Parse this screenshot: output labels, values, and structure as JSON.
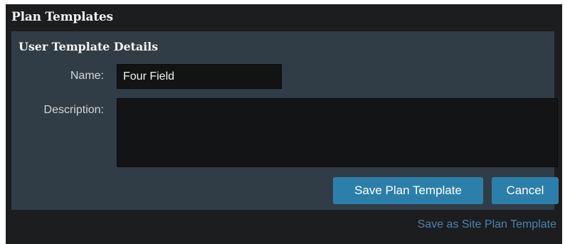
{
  "window": {
    "title": "Plan Templates"
  },
  "panel": {
    "title": "User Template Details",
    "name_label": "Name:",
    "name_value": "Four Field",
    "description_label": "Description:",
    "description_value": ""
  },
  "actions": {
    "save_label": "Save Plan Template",
    "cancel_label": "Cancel",
    "site_link_label": "Save as Site Plan Template"
  },
  "colors": {
    "window_bg": "#1c1d1f",
    "panel_bg": "#313d46",
    "input_bg": "#121313",
    "button_bg": "#2c7fab",
    "link": "#4d84aa",
    "text": "#f1f3f5"
  }
}
